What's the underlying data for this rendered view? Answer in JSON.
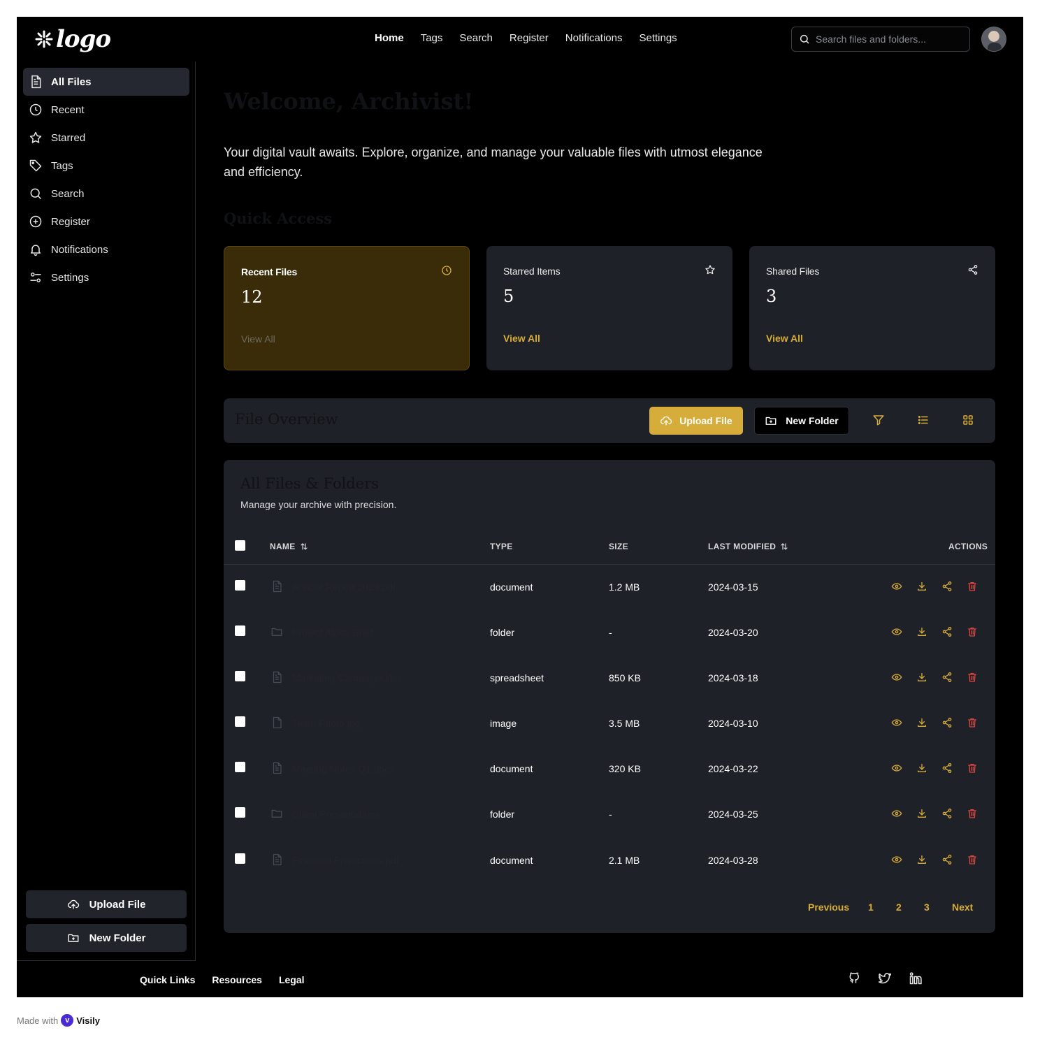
{
  "brand": {
    "logo_text": "logo"
  },
  "topnav": {
    "items": [
      "Home",
      "Tags",
      "Search",
      "Register",
      "Notifications",
      "Settings"
    ],
    "active": "Home"
  },
  "search": {
    "placeholder": "Search files and folders..."
  },
  "sidebar": {
    "items": [
      {
        "label": "All Files",
        "icon": "file-icon",
        "active": true
      },
      {
        "label": "Recent",
        "icon": "clock-icon"
      },
      {
        "label": "Starred",
        "icon": "star-icon"
      },
      {
        "label": "Tags",
        "icon": "tag-icon"
      },
      {
        "label": "Search",
        "icon": "search-icon"
      },
      {
        "label": "Register",
        "icon": "plus-circle-icon"
      },
      {
        "label": "Notifications",
        "icon": "bell-icon"
      },
      {
        "label": "Settings",
        "icon": "sliders-icon"
      }
    ],
    "upload_label": "Upload File",
    "new_folder_label": "New Folder"
  },
  "main": {
    "welcome": "Welcome, Archivist!",
    "intro": "Your digital vault awaits. Explore, organize, and manage your valuable files with utmost elegance and efficiency.",
    "quick_access_title": "Quick Access",
    "cards": [
      {
        "title": "Recent Files",
        "count": "12",
        "link": "View All",
        "icon": "clock-icon"
      },
      {
        "title": "Starred Items",
        "count": "5",
        "link": "View All",
        "icon": "star-icon"
      },
      {
        "title": "Shared Files",
        "count": "3",
        "link": "View All",
        "icon": "share-icon"
      }
    ],
    "toolbar": {
      "title": "File Overview",
      "upload_label": "Upload File",
      "new_folder_label": "New Folder"
    },
    "table": {
      "title": "All Files & Folders",
      "subtitle": "Manage your archive with precision.",
      "columns": {
        "name": "NAME",
        "type": "TYPE",
        "size": "SIZE",
        "modified": "LAST MODIFIED",
        "actions": "ACTIONS"
      },
      "rows": [
        {
          "name": "Annual Report 2023.pdf",
          "type": "document",
          "size": "1.2 MB",
          "modified": "2024-03-15",
          "icon": "document-icon"
        },
        {
          "name": "Project Alpha Brief",
          "type": "folder",
          "size": "-",
          "modified": "2024-03-20",
          "icon": "folder-icon"
        },
        {
          "name": "Marketing Campaign.xlsx",
          "type": "spreadsheet",
          "size": "850 KB",
          "modified": "2024-03-18",
          "icon": "document-icon"
        },
        {
          "name": "Team Photo.jpg",
          "type": "image",
          "size": "3.5 MB",
          "modified": "2024-03-10",
          "icon": "file-icon"
        },
        {
          "name": "Meeting Notes Q1.docx",
          "type": "document",
          "size": "320 KB",
          "modified": "2024-03-22",
          "icon": "document-icon"
        },
        {
          "name": "Client Presentations",
          "type": "folder",
          "size": "-",
          "modified": "2024-03-25",
          "icon": "folder-icon"
        },
        {
          "name": "Financial Projections.pdf",
          "type": "document",
          "size": "2.1 MB",
          "modified": "2024-03-28",
          "icon": "document-icon"
        }
      ]
    },
    "pagination": {
      "previous": "Previous",
      "pages": [
        "1",
        "2",
        "3"
      ],
      "next": "Next"
    }
  },
  "footer": {
    "links": [
      "Quick Links",
      "Resources",
      "Legal"
    ],
    "social": [
      "github-icon",
      "twitter-icon",
      "linkedin-icon"
    ]
  },
  "made_with": {
    "prefix": "Made with",
    "brand": "Visily"
  },
  "colors": {
    "accent": "#d6ad3a",
    "danger": "#d9463f",
    "card": "#1f2128",
    "highlight_card": "#3a2c08"
  }
}
